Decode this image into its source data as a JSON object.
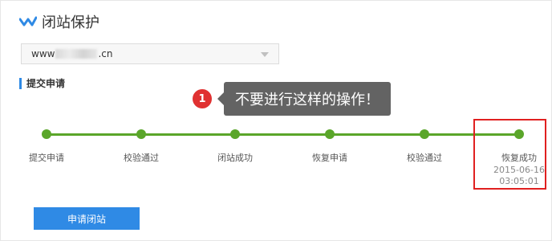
{
  "header": {
    "title": "闭站保护",
    "logo_icon": "check-logo-icon"
  },
  "domain_select": {
    "prefix": "www",
    "suffix": ".cn"
  },
  "section": {
    "title": "提交申请"
  },
  "annotation": {
    "number": "1",
    "text": "不要进行这样的操作！"
  },
  "steps": [
    {
      "label": "提交申请"
    },
    {
      "label": "校验通过"
    },
    {
      "label": "闭站成功"
    },
    {
      "label": "恢复申请"
    },
    {
      "label": "校验通过"
    },
    {
      "label": "恢复成功",
      "date": "2015-06-16",
      "time": "03:05:01"
    }
  ],
  "apply_button": {
    "label": "申请闭站"
  },
  "colors": {
    "accent_blue": "#2f8ae5",
    "progress_green": "#5aa62a",
    "highlight_red": "#e02020",
    "annotation_gray": "#636363"
  }
}
